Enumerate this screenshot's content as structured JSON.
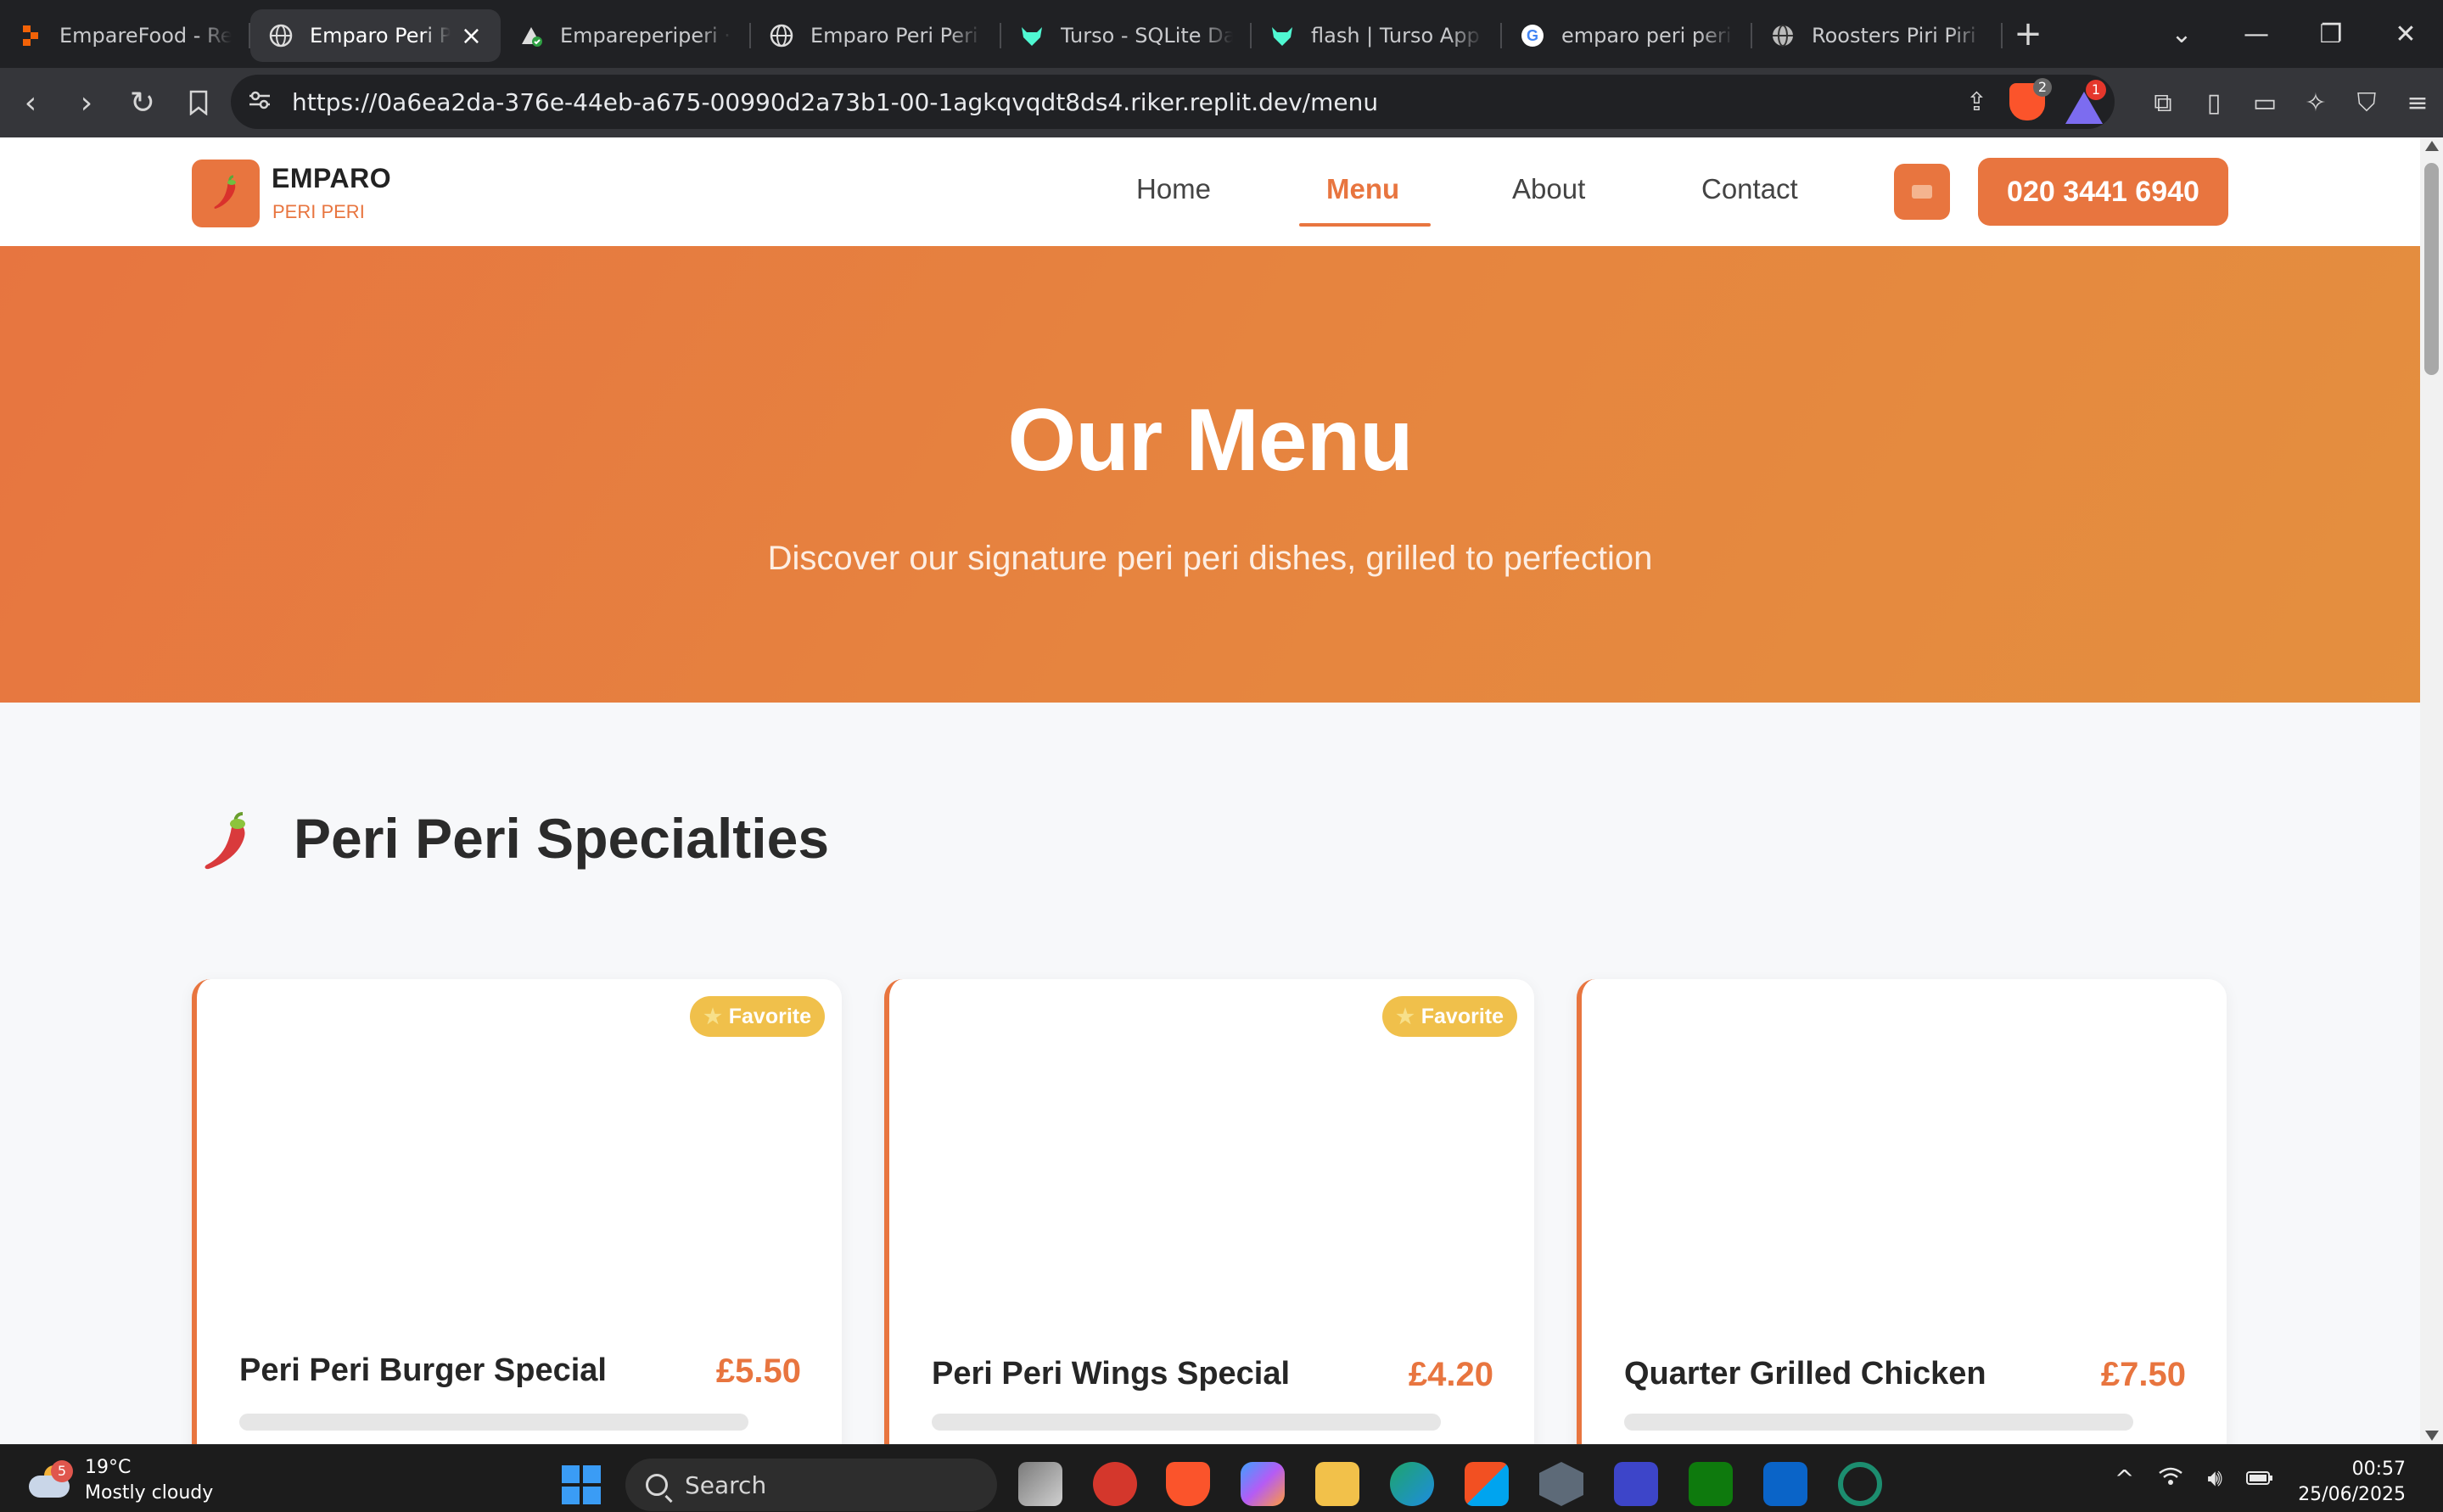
{
  "browser": {
    "tabs": [
      {
        "title": "EmpareFood - Replit",
        "icon": "replit-icon",
        "active": false
      },
      {
        "title": "Emparo Peri Peri",
        "icon": "globe-icon",
        "active": true
      },
      {
        "title": "Empareperiperi · Vercel",
        "icon": "vercel-check-icon",
        "active": false
      },
      {
        "title": "Emparo Peri Peri - Menu",
        "icon": "globe-icon",
        "active": false
      },
      {
        "title": "Turso - SQLite Database",
        "icon": "turso-icon",
        "active": false
      },
      {
        "title": "flash | Turso App",
        "icon": "turso-icon",
        "active": false
      },
      {
        "title": "emparo peri peri - Google",
        "icon": "google-icon",
        "active": false
      },
      {
        "title": "Roosters Piri Piri - London",
        "icon": "globe-icon",
        "active": false
      }
    ],
    "url": "https://0a6ea2da-376e-44eb-a675-00990d2a73b1-00-1agkqvqdt8ds4.riker.replit.dev/menu",
    "shield_badge": "2",
    "rewards_badge": "1"
  },
  "site": {
    "brand": {
      "name": "EMPARO",
      "tagline": "PERI PERI"
    },
    "nav": [
      {
        "label": "Home",
        "active": false
      },
      {
        "label": "Menu",
        "active": true
      },
      {
        "label": "About",
        "active": false
      },
      {
        "label": "Contact",
        "active": false
      }
    ],
    "phone": "020 3441 6940",
    "hero": {
      "title": "Our Menu",
      "subtitle": "Discover our signature peri peri dishes, grilled to perfection"
    },
    "section": {
      "title": "Peri Peri Specialties",
      "icon": "chili-pepper-icon"
    },
    "items": [
      {
        "name": "Peri Peri Burger Special",
        "price": "£5.50",
        "badge": "Favorite"
      },
      {
        "name": "Peri Peri Wings Special",
        "price": "£4.20",
        "badge": "Favorite"
      },
      {
        "name": "Quarter Grilled Chicken",
        "price": "£7.50",
        "badge": ""
      }
    ]
  },
  "taskbar": {
    "weather": {
      "temp": "19°C",
      "condition": "Mostly cloudy",
      "badge": "5"
    },
    "search_placeholder": "Search",
    "time": "00:57",
    "date": "25/06/2025"
  },
  "colors": {
    "accent": "#e8753f",
    "favorite": "#f0c04b",
    "hero_start": "#e77540",
    "hero_end": "#e48f3f"
  }
}
